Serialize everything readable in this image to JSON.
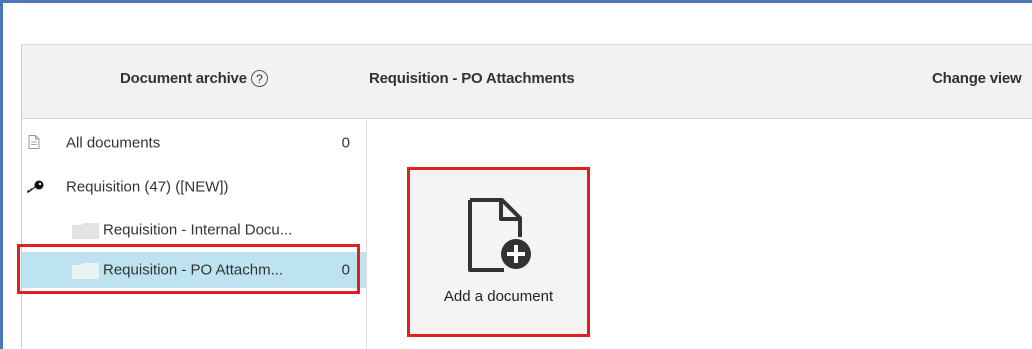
{
  "header": {
    "archive_label": "Document archive",
    "help_symbol": "?",
    "title": "Requisition - PO Attachments",
    "change_view_label": "Change view"
  },
  "tree": {
    "items": [
      {
        "label": "All documents",
        "count": "0",
        "icon": "document-icon"
      },
      {
        "label": "Requisition (47) ([NEW])",
        "count": "",
        "icon": "key-icon"
      },
      {
        "label": "Requisition - Internal Docu...",
        "count": "",
        "icon": "folder-icon"
      },
      {
        "label": "Requisition - PO Attachm...",
        "count": "0",
        "icon": "folder-icon",
        "selected": true
      }
    ]
  },
  "content": {
    "add_document_label": "Add a document",
    "add_document_icon": "add-document-icon"
  },
  "colors": {
    "selected_row": "#bde3f1",
    "highlight_border": "#e0201f",
    "header_bg": "#f2f2f2",
    "window_accent": "#4d78b6"
  }
}
